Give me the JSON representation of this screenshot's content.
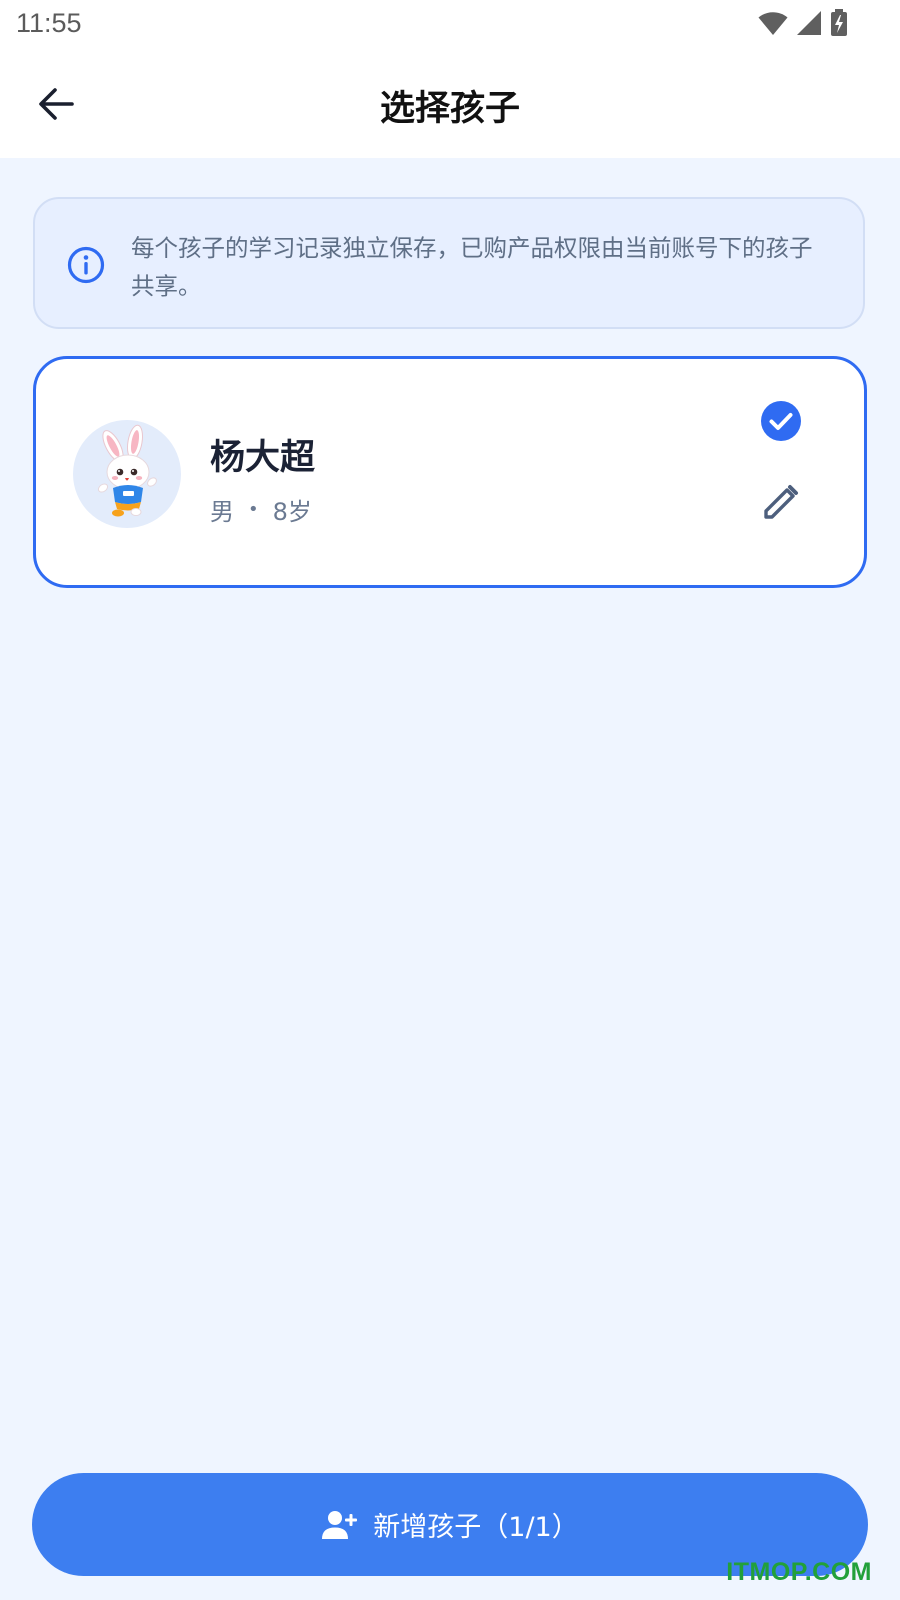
{
  "status_bar": {
    "time": "11:55"
  },
  "header": {
    "title": "选择孩子"
  },
  "notice": {
    "text": "每个孩子的学习记录独立保存，已购产品权限由当前账号下的孩子共享。"
  },
  "children": [
    {
      "name": "杨大超",
      "gender": "男",
      "separator": "•",
      "age": "8岁",
      "selected": true
    }
  ],
  "add_button": {
    "label": "新增孩子（1/1）"
  },
  "watermark": {
    "text": "ITMOP.COM"
  },
  "colors": {
    "primary": "#3d7ef0",
    "card_border": "#2f6bf2",
    "page_background": "#eff5ff",
    "notice_background": "#e7efff",
    "watermark": "#22a03a"
  }
}
